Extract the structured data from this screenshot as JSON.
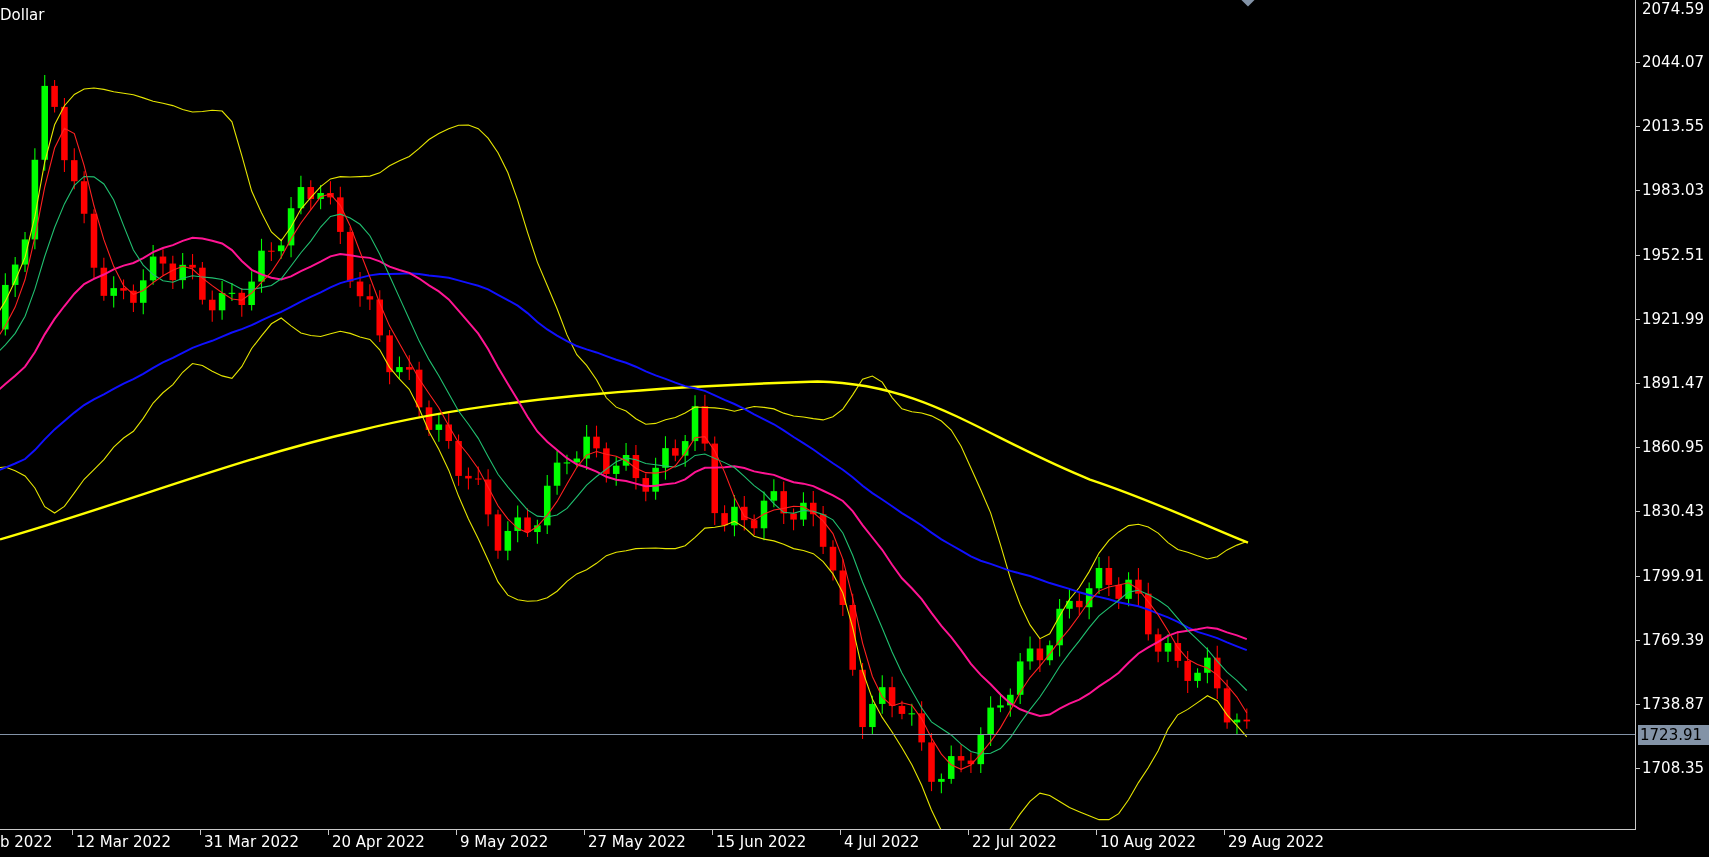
{
  "title": "Dollar",
  "price_axis": [
    "2074.59",
    "2044.07",
    "2013.55",
    "1983.03",
    "1952.51",
    "1921.99",
    "1891.47",
    "1860.95",
    "1830.43",
    "1799.91",
    "1769.39",
    "1738.87",
    "1708.35"
  ],
  "current_price": {
    "label": "1723.91"
  },
  "date_axis": [
    "b 2022",
    "12 Mar 2022",
    "31 Mar 2022",
    "20 Apr 2022",
    "9 May 2022",
    "27 May 2022",
    "15 Jun 2022",
    "4 Jul 2022",
    "22 Jul 2022",
    "10 Aug 2022",
    "29 Aug 2022"
  ]
}
